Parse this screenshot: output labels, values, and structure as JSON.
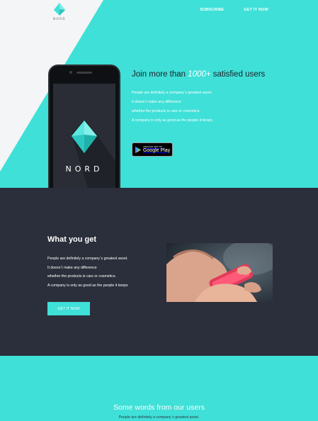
{
  "header": {
    "logo_text": "NORD",
    "nav": [
      {
        "label": "SUBSCRIBE"
      },
      {
        "label": "GET IT NOW"
      }
    ]
  },
  "hero": {
    "headline_before": "Join more than ",
    "headline_highlight": "1000+",
    "headline_after": " satisfied users",
    "lines": [
      "People are definitely a company`s greatest asset.",
      "It doesn`t make any difference",
      "whether the products is cars or cosmetics.",
      "A company is only as good as the people it keeps."
    ],
    "phone_brand": "NORD",
    "store_badge": {
      "small": "ANDROID APP ON",
      "big": "Google Play"
    }
  },
  "features": {
    "title": "What you get",
    "lines": [
      "People are definitely a company`s greatest asset.",
      "It doesn`t make any difference",
      "whether the products is cars or cosmetics.",
      "A company is only as good as the people it keeps"
    ],
    "button_label": "GET IT NOW"
  },
  "testimonials": {
    "title": "Some words from our users",
    "line": "People are definitely a company`s greatest asset."
  },
  "colors": {
    "accent": "#3fe0d8",
    "dark": "#2b2f3b",
    "white": "#ffffff"
  }
}
